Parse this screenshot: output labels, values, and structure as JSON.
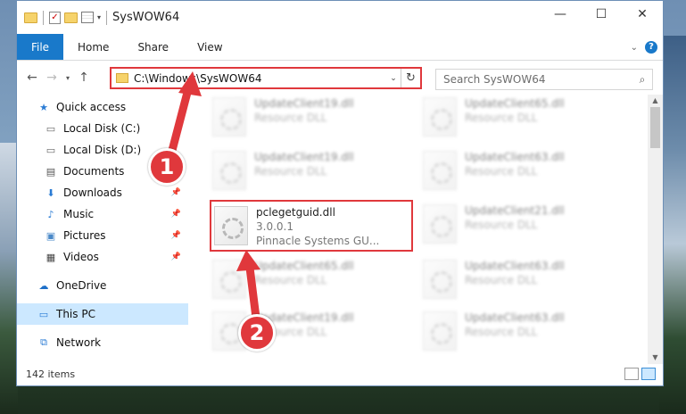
{
  "window": {
    "title": "SysWOW64"
  },
  "titlebar": {
    "minimize_glyph": "—",
    "maximize_glyph": "☐",
    "close_glyph": "✕"
  },
  "ribbon": {
    "tabs": [
      {
        "label": "File",
        "active": true
      },
      {
        "label": "Home"
      },
      {
        "label": "Share"
      },
      {
        "label": "View"
      }
    ],
    "help": "?"
  },
  "navigation": {
    "address": "C:\\Windows\\SysWOW64",
    "search_placeholder": "Search SysWOW64"
  },
  "sidebar": {
    "items": [
      {
        "label": "Quick access",
        "icon": "star-icon",
        "pinned": false
      },
      {
        "label": "Local Disk (C:)",
        "icon": "drive-icon",
        "pinned": false
      },
      {
        "label": "Local Disk (D:)",
        "icon": "drive-icon",
        "pinned": false
      },
      {
        "label": "Documents",
        "icon": "documents-icon",
        "pinned": false
      },
      {
        "label": "Downloads",
        "icon": "downloads-icon",
        "pinned": true
      },
      {
        "label": "Music",
        "icon": "music-icon",
        "pinned": true
      },
      {
        "label": "Pictures",
        "icon": "pictures-icon",
        "pinned": true
      },
      {
        "label": "Videos",
        "icon": "videos-icon",
        "pinned": true
      },
      {
        "label": "OneDrive",
        "icon": "cloud-icon",
        "pinned": false
      },
      {
        "label": "This PC",
        "icon": "pc-icon",
        "pinned": false,
        "selected": true
      },
      {
        "label": "Network",
        "icon": "network-icon",
        "pinned": false
      }
    ]
  },
  "files": [
    {
      "name": "UpdateClient19.dll",
      "sub": "Resource DLL",
      "blurred": true
    },
    {
      "name": "UpdateClient65.dll",
      "sub": "Resource DLL",
      "blurred": true
    },
    {
      "name": "UpdateClient19.dll",
      "sub": "Resource DLL",
      "blurred": true
    },
    {
      "name": "UpdateClient63.dll",
      "sub": "Resource DLL",
      "blurred": true
    },
    {
      "name": "pclegetguid.dll",
      "version": "3.0.0.1",
      "company": "Pinnacle Systems GU...",
      "highlighted": true
    },
    {
      "name": "UpdateClient21.dll",
      "sub": "Resource DLL",
      "blurred": true
    },
    {
      "name": "UpdateClient65.dll",
      "sub": "Resource DLL",
      "blurred": true
    },
    {
      "name": "UpdateClient63.dll",
      "sub": "Resource DLL",
      "blurred": true
    },
    {
      "name": "UpdateClient19.dll",
      "sub": "Resource DLL",
      "blurred": true
    },
    {
      "name": "UpdateClient63.dll",
      "sub": "Resource DLL",
      "blurred": true
    }
  ],
  "status": {
    "item_count": "142 items"
  },
  "annotations": {
    "step1": "1",
    "step2": "2"
  },
  "colors": {
    "accent": "#1979ca",
    "highlight": "#e0383c",
    "selection": "#cce8ff"
  }
}
